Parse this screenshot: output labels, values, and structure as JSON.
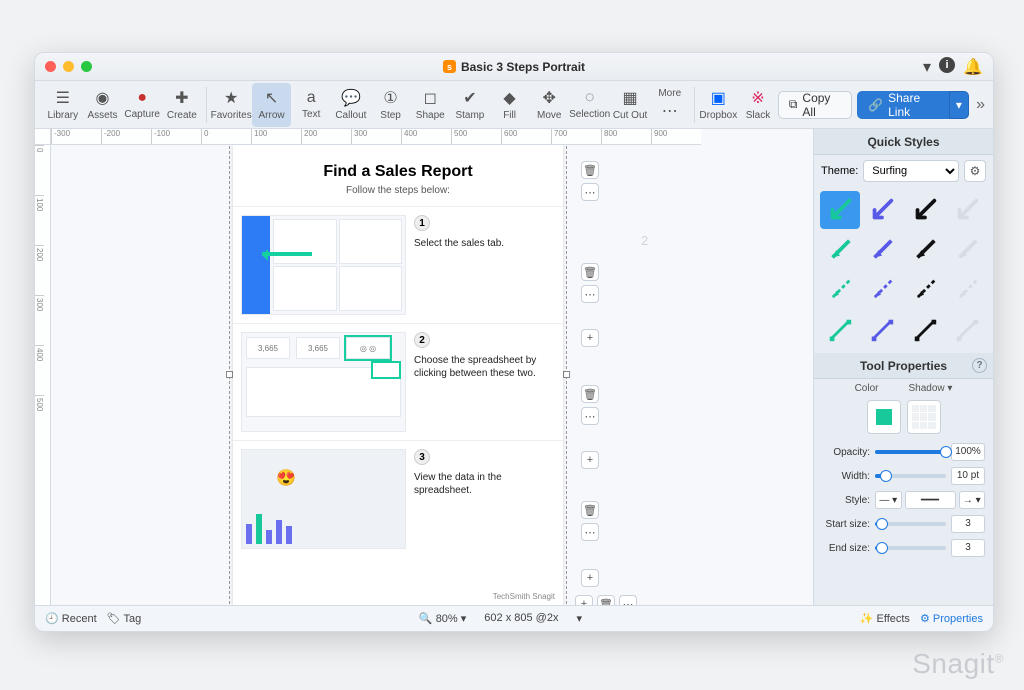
{
  "title": "Basic 3 Steps Portrait",
  "toolbar": {
    "library": "Library",
    "assets": "Assets",
    "capture": "Capture",
    "create": "Create",
    "favorites": "Favorites",
    "arrow": "Arrow",
    "text": "Text",
    "callout": "Callout",
    "step": "Step",
    "shape": "Shape",
    "stamp": "Stamp",
    "fill": "Fill",
    "move": "Move",
    "selection": "Selection",
    "cutout": "Cut Out",
    "more": "More",
    "dropbox": "Dropbox",
    "slack": "Slack",
    "copyall": "Copy All",
    "sharelink": "Share Link"
  },
  "ruler_h": [
    "-300",
    "-200",
    "-100",
    "0",
    "100",
    "200",
    "300",
    "400",
    "500",
    "600",
    "700",
    "800",
    "900"
  ],
  "ruler_v": [
    "0",
    "100",
    "200",
    "300",
    "400",
    "500"
  ],
  "doc": {
    "title": "Find a Sales Report",
    "sub": "Follow the steps below:",
    "steps": [
      {
        "num": "1",
        "text": "Select the sales tab."
      },
      {
        "num": "2",
        "text": "Choose the spreadsheet by clicking between these two."
      },
      {
        "num": "3",
        "text": "View the data in the spreadsheet."
      }
    ],
    "step2_values": [
      "3,665",
      "3,665"
    ],
    "footer": "TechSmith Snagit"
  },
  "panel": {
    "quickstyles": "Quick Styles",
    "theme_label": "Theme:",
    "theme_value": "Surfing",
    "toolprops": "Tool Properties",
    "color": "Color",
    "shadow": "Shadow ▾",
    "opacity": "Opacity:",
    "opacity_val": "100%",
    "width": "Width:",
    "width_val": "10 pt",
    "style": "Style:",
    "startsize": "Start size:",
    "startsize_val": "3",
    "endsize": "End size:",
    "endsize_val": "3"
  },
  "status": {
    "recent": "Recent",
    "tag": "Tag",
    "zoom": "80%",
    "dims": "602 x 805 @2x",
    "effects": "Effects",
    "properties": "Properties"
  },
  "ghost": "2",
  "brand": "Snagit"
}
